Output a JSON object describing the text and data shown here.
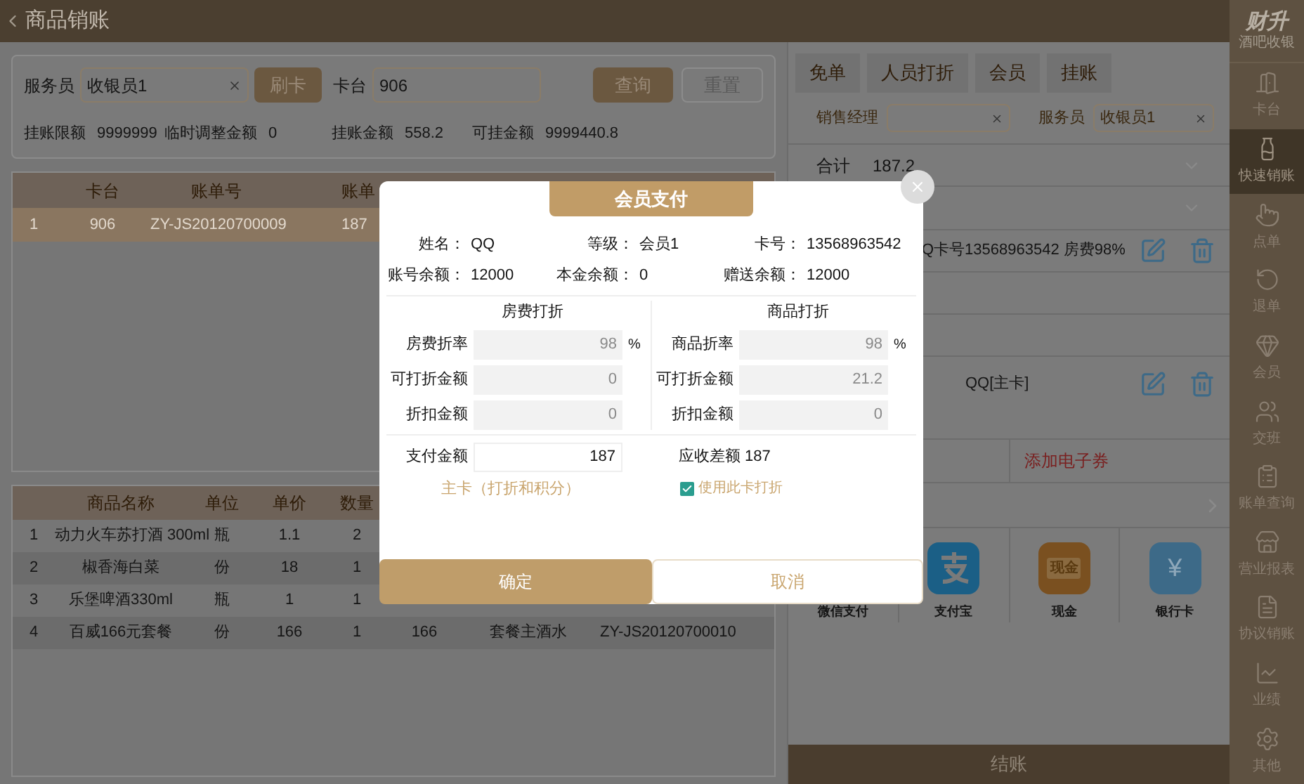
{
  "header": {
    "title": "商品销账"
  },
  "filter": {
    "waiter_label": "服务员",
    "waiter_value": "收银员1",
    "swipe_button": "刷卡",
    "table_label": "卡台",
    "table_value": "906",
    "query_button": "查询",
    "reset_button": "重置",
    "stats": [
      {
        "label": "挂账限额",
        "value": "9999999"
      },
      {
        "label": "临时调整金额",
        "value": "0"
      },
      {
        "label": "挂账金额",
        "value": "558.2"
      },
      {
        "label": "可挂金额",
        "value": "9999440.8"
      }
    ]
  },
  "bill_table": {
    "columns": [
      "卡台",
      "账单号",
      "账单"
    ],
    "rows": [
      {
        "index": "1",
        "cells": [
          "906",
          "ZY-JS20120700009",
          "187"
        ],
        "selected": true
      }
    ]
  },
  "goods_table": {
    "columns": [
      "商品名称",
      "单位",
      "单价",
      "数量"
    ],
    "rows": [
      {
        "index": "1",
        "cells": [
          "动力火车苏打酒 300ml",
          "瓶",
          "1.1",
          "2"
        ]
      },
      {
        "index": "2",
        "cells": [
          "椒香海白菜",
          "份",
          "18",
          "1"
        ]
      },
      {
        "index": "3",
        "cells": [
          "乐堡啤酒330ml",
          "瓶",
          "1",
          "1"
        ]
      },
      {
        "index": "4",
        "cells": [
          "百威166元套餐",
          "份",
          "166",
          "1",
          "166",
          "套餐主酒水",
          "ZY-JS20120700010"
        ]
      }
    ]
  },
  "right_panel": {
    "tabs": [
      {
        "label": "免单"
      },
      {
        "label": "人员打折"
      },
      {
        "label": "会员"
      },
      {
        "label": "挂账"
      }
    ],
    "manager_label": "销售经理",
    "waiter_label": "服务员",
    "waiter_value": "收银员1",
    "total_label": "合计",
    "total_value": "187.2",
    "discount_lines": [
      {
        "text": "Q卡号13568963542 房费98%"
      },
      {
        "text": "QQ[主卡]"
      }
    ],
    "coupon_link": "添加电子券",
    "payment_methods": [
      {
        "label": "微信支付",
        "kind": "wechat"
      },
      {
        "label": "支付宝",
        "kind": "alipay"
      },
      {
        "label": "现金",
        "kind": "cash",
        "icon_text": "现金"
      },
      {
        "label": "银行卡",
        "kind": "bank",
        "icon_text": "¥"
      }
    ],
    "checkout_button": "结账"
  },
  "sidebar": {
    "brand": "财升",
    "subtitle": "酒吧收银",
    "items": [
      {
        "label": "卡台",
        "kind": "door",
        "selected": false
      },
      {
        "label": "快速销账",
        "kind": "bottle",
        "selected": true
      },
      {
        "label": "点单",
        "kind": "hand",
        "selected": false
      },
      {
        "label": "退单",
        "kind": "undo",
        "selected": false
      },
      {
        "label": "会员",
        "kind": "gem",
        "selected": false
      },
      {
        "label": "交班",
        "kind": "users",
        "selected": false
      },
      {
        "label": "账单查询",
        "kind": "clipboard",
        "selected": false
      },
      {
        "label": "营业报表",
        "kind": "store",
        "selected": false
      },
      {
        "label": "协议销账",
        "kind": "document",
        "selected": false
      },
      {
        "label": "业绩",
        "kind": "chart",
        "selected": false
      },
      {
        "label": "其他",
        "kind": "settings",
        "selected": false
      }
    ]
  },
  "dialog": {
    "title": "会员支付",
    "info": [
      {
        "label": "姓名：",
        "value": "QQ"
      },
      {
        "label": "等级：",
        "value": "会员1"
      },
      {
        "label": "卡号：",
        "value": "13568963542"
      },
      {
        "label": "账号余额：",
        "value": "12000"
      },
      {
        "label": "本金余额：",
        "value": "0"
      },
      {
        "label": "赠送余额：",
        "value": "12000"
      }
    ],
    "sections": [
      {
        "title": "房费打折",
        "rows": [
          {
            "label": "房费折率",
            "value": "98",
            "unit": "%"
          },
          {
            "label": "可打折金额",
            "value": "0"
          },
          {
            "label": "折扣金额",
            "value": "0"
          }
        ]
      },
      {
        "title": "商品打折",
        "rows": [
          {
            "label": "商品折率",
            "value": "98",
            "unit": "%"
          },
          {
            "label": "可打折金额",
            "value": "21.2"
          },
          {
            "label": "折扣金额",
            "value": "0"
          }
        ]
      }
    ],
    "pay_label": "支付金额",
    "pay_value": "187",
    "difference": "应收差额 187",
    "card_note": "主卡（打折和积分）",
    "use_card": {
      "label": "使用此卡打折",
      "checked": true
    },
    "confirm_button": "确定",
    "cancel_button": "取消"
  }
}
